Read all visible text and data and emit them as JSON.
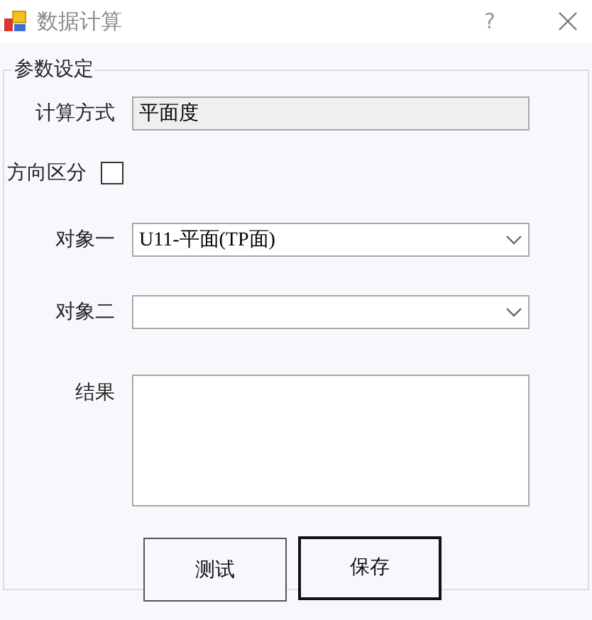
{
  "window": {
    "title": "数据计算",
    "help": "?"
  },
  "group": {
    "legend": "参数设定",
    "fields": [
      {
        "kind": "text",
        "label": "计算方式",
        "value": "平面度",
        "readonly": true
      },
      {
        "kind": "checkbox",
        "label": "方向区分",
        "checked": false
      },
      {
        "kind": "combo",
        "label": "对象一",
        "value": "U11-平面(TP面)"
      },
      {
        "kind": "combo",
        "label": "对象二"
      },
      {
        "kind": "textarea",
        "label": "结果"
      }
    ],
    "buttons": [
      {
        "label": "测试",
        "default": false
      },
      {
        "label": "保存",
        "default": true
      }
    ]
  }
}
